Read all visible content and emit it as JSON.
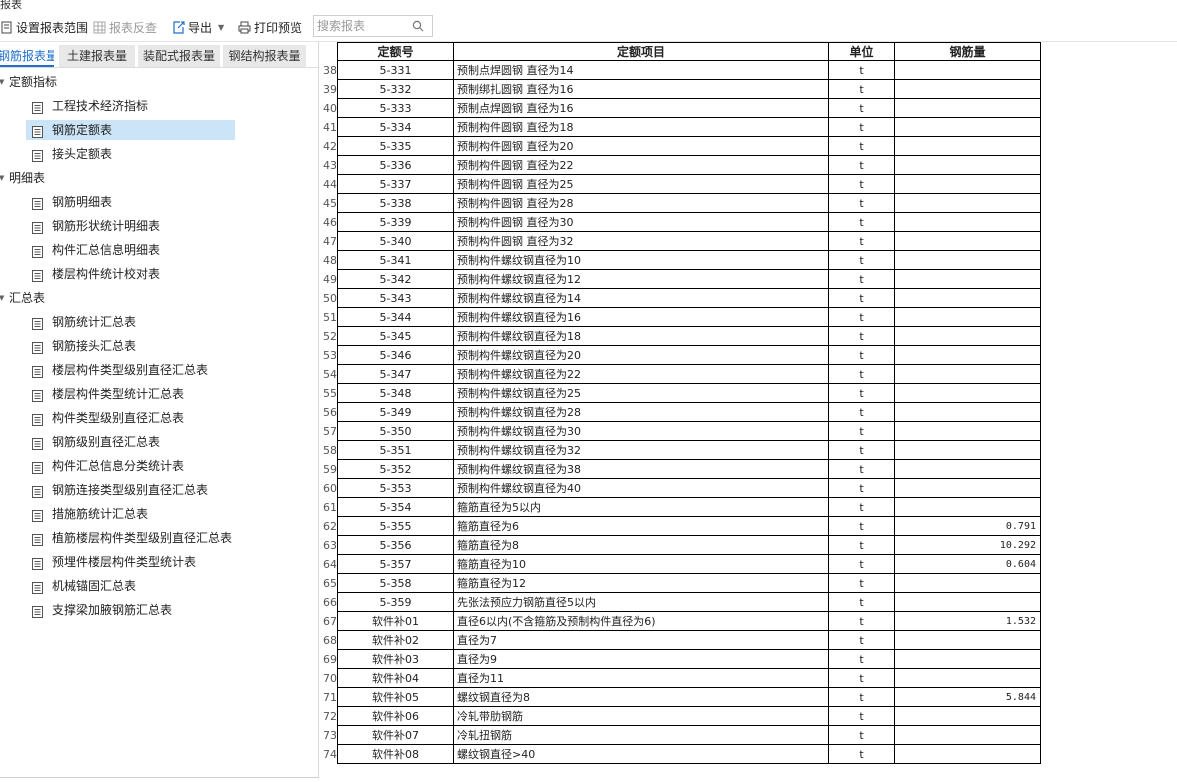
{
  "window": {
    "title": "报表"
  },
  "toolbar": {
    "set_range": "设置报表范围",
    "reverse_check": "报表反查",
    "export": "导出",
    "print_preview": "打印预览",
    "search_placeholder": "搜索报表"
  },
  "tabs": [
    {
      "label": "钢筋报表量",
      "active": true
    },
    {
      "label": "土建报表量",
      "active": false
    },
    {
      "label": "装配式报表量",
      "active": false
    },
    {
      "label": "钢结构报表量",
      "active": false
    }
  ],
  "tree": {
    "groups": [
      {
        "label": "定额指标",
        "items": [
          "工程技术经济指标",
          "钢筋定额表",
          "接头定额表"
        ]
      },
      {
        "label": "明细表",
        "items": [
          "钢筋明细表",
          "钢筋形状统计明细表",
          "构件汇总信息明细表",
          "楼层构件统计校对表"
        ]
      },
      {
        "label": "汇总表",
        "items": [
          "钢筋统计汇总表",
          "钢筋接头汇总表",
          "楼层构件类型级别直径汇总表",
          "楼层构件类型统计汇总表",
          "构件类型级别直径汇总表",
          "钢筋级别直径汇总表",
          "构件汇总信息分类统计表",
          "钢筋连接类型级别直径汇总表",
          "措施筋统计汇总表",
          "植筋楼层构件类型级别直径汇总表",
          "预埋件楼层构件类型统计表",
          "机械锚固汇总表",
          "支撑梁加腋钢筋汇总表"
        ]
      }
    ],
    "selected": "钢筋定额表"
  },
  "table": {
    "headers": {
      "code": "定额号",
      "name": "定额项目",
      "unit": "单位",
      "amount": "钢筋量"
    },
    "rows": [
      {
        "n": "38",
        "code": "5-331",
        "name": "预制点焊圆钢 直径为14",
        "unit": "t",
        "amount": ""
      },
      {
        "n": "39",
        "code": "5-332",
        "name": "预制绑扎圆钢 直径为16",
        "unit": "t",
        "amount": ""
      },
      {
        "n": "40",
        "code": "5-333",
        "name": "预制点焊圆钢 直径为16",
        "unit": "t",
        "amount": ""
      },
      {
        "n": "41",
        "code": "5-334",
        "name": "预制构件圆钢 直径为18",
        "unit": "t",
        "amount": ""
      },
      {
        "n": "42",
        "code": "5-335",
        "name": "预制构件圆钢 直径为20",
        "unit": "t",
        "amount": ""
      },
      {
        "n": "43",
        "code": "5-336",
        "name": "预制构件圆钢 直径为22",
        "unit": "t",
        "amount": ""
      },
      {
        "n": "44",
        "code": "5-337",
        "name": "预制构件圆钢 直径为25",
        "unit": "t",
        "amount": ""
      },
      {
        "n": "45",
        "code": "5-338",
        "name": "预制构件圆钢 直径为28",
        "unit": "t",
        "amount": ""
      },
      {
        "n": "46",
        "code": "5-339",
        "name": "预制构件圆钢 直径为30",
        "unit": "t",
        "amount": ""
      },
      {
        "n": "47",
        "code": "5-340",
        "name": "预制构件圆钢 直径为32",
        "unit": "t",
        "amount": ""
      },
      {
        "n": "48",
        "code": "5-341",
        "name": "预制构件螺纹钢直径为10",
        "unit": "t",
        "amount": ""
      },
      {
        "n": "49",
        "code": "5-342",
        "name": "预制构件螺纹钢直径为12",
        "unit": "t",
        "amount": ""
      },
      {
        "n": "50",
        "code": "5-343",
        "name": "预制构件螺纹钢直径为14",
        "unit": "t",
        "amount": ""
      },
      {
        "n": "51",
        "code": "5-344",
        "name": "预制构件螺纹钢直径为16",
        "unit": "t",
        "amount": ""
      },
      {
        "n": "52",
        "code": "5-345",
        "name": "预制构件螺纹钢直径为18",
        "unit": "t",
        "amount": ""
      },
      {
        "n": "53",
        "code": "5-346",
        "name": "预制构件螺纹钢直径为20",
        "unit": "t",
        "amount": ""
      },
      {
        "n": "54",
        "code": "5-347",
        "name": "预制构件螺纹钢直径为22",
        "unit": "t",
        "amount": ""
      },
      {
        "n": "55",
        "code": "5-348",
        "name": "预制构件螺纹钢直径为25",
        "unit": "t",
        "amount": ""
      },
      {
        "n": "56",
        "code": "5-349",
        "name": "预制构件螺纹钢直径为28",
        "unit": "t",
        "amount": ""
      },
      {
        "n": "57",
        "code": "5-350",
        "name": "预制构件螺纹钢直径为30",
        "unit": "t",
        "amount": ""
      },
      {
        "n": "58",
        "code": "5-351",
        "name": "预制构件螺纹钢直径为32",
        "unit": "t",
        "amount": ""
      },
      {
        "n": "59",
        "code": "5-352",
        "name": "预制构件螺纹钢直径为38",
        "unit": "t",
        "amount": ""
      },
      {
        "n": "60",
        "code": "5-353",
        "name": "预制构件螺纹钢直径为40",
        "unit": "t",
        "amount": ""
      },
      {
        "n": "61",
        "code": "5-354",
        "name": "箍筋直径为5以内",
        "unit": "t",
        "amount": ""
      },
      {
        "n": "62",
        "code": "5-355",
        "name": "箍筋直径为6",
        "unit": "t",
        "amount": "0.791"
      },
      {
        "n": "63",
        "code": "5-356",
        "name": "箍筋直径为8",
        "unit": "t",
        "amount": "10.292"
      },
      {
        "n": "64",
        "code": "5-357",
        "name": "箍筋直径为10",
        "unit": "t",
        "amount": "0.604"
      },
      {
        "n": "65",
        "code": "5-358",
        "name": "箍筋直径为12",
        "unit": "t",
        "amount": ""
      },
      {
        "n": "66",
        "code": "5-359",
        "name": "先张法预应力钢筋直径5以内",
        "unit": "t",
        "amount": ""
      },
      {
        "n": "67",
        "code": "软件补01",
        "name": "直径6以内(不含箍筋及预制构件直径为6)",
        "unit": "t",
        "amount": "1.532"
      },
      {
        "n": "68",
        "code": "软件补02",
        "name": "直径为7",
        "unit": "t",
        "amount": ""
      },
      {
        "n": "69",
        "code": "软件补03",
        "name": "直径为9",
        "unit": "t",
        "amount": ""
      },
      {
        "n": "70",
        "code": "软件补04",
        "name": "直径为11",
        "unit": "t",
        "amount": ""
      },
      {
        "n": "71",
        "code": "软件补05",
        "name": "螺纹钢直径为8",
        "unit": "t",
        "amount": "5.844"
      },
      {
        "n": "72",
        "code": "软件补06",
        "name": "冷轧带肋钢筋",
        "unit": "t",
        "amount": ""
      },
      {
        "n": "73",
        "code": "软件补07",
        "name": "冷轧扭钢筋",
        "unit": "t",
        "amount": ""
      },
      {
        "n": "74",
        "code": "软件补08",
        "name": "螺纹钢直径>40",
        "unit": "t",
        "amount": ""
      }
    ]
  },
  "colors": {
    "selected_bg": "#cce4f7",
    "active_tab": "#1f6fc9",
    "grid_line": "#000000"
  }
}
